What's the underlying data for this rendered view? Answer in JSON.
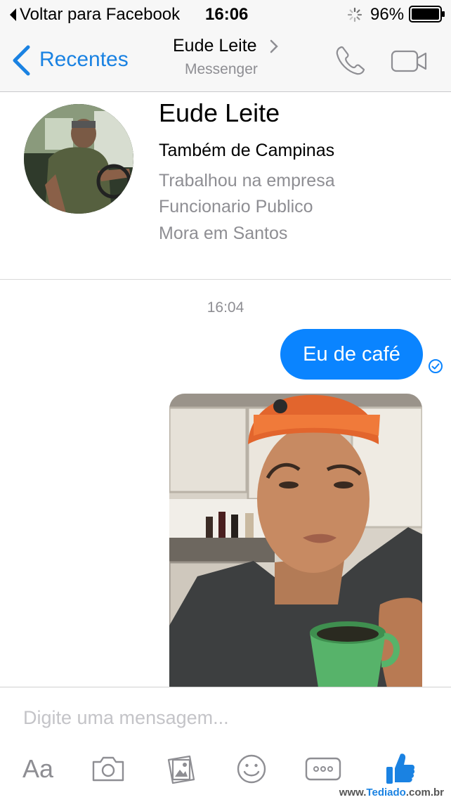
{
  "status_bar": {
    "back_app_label": "Voltar para Facebook",
    "time": "16:06",
    "battery_percent": "96%",
    "battery_level": 0.96
  },
  "nav": {
    "back_label": "Recentes",
    "title": "Eude Leite",
    "subtitle": "Messenger",
    "accent_color": "#1a82e2"
  },
  "profile": {
    "name": "Eude Leite",
    "location": "Também de Campinas",
    "details": [
      "Trabalhou na empresa",
      "Funcionario Publico",
      "Mora em Santos"
    ]
  },
  "conversation": {
    "timestamp": "16:04",
    "messages": [
      {
        "from": "me",
        "type": "text",
        "text": "Eu de café",
        "color": "#0a84ff"
      },
      {
        "from": "me",
        "type": "photo"
      }
    ]
  },
  "composer": {
    "placeholder": "Digite uma mensagem...",
    "text_tool_label": "Aa",
    "tools": [
      "camera-icon",
      "gallery-icon",
      "emoji-icon",
      "more-icon",
      "like-icon"
    ]
  },
  "watermark": {
    "prefix": "www.",
    "brand": "Tediado",
    "suffix": ".com.br"
  }
}
